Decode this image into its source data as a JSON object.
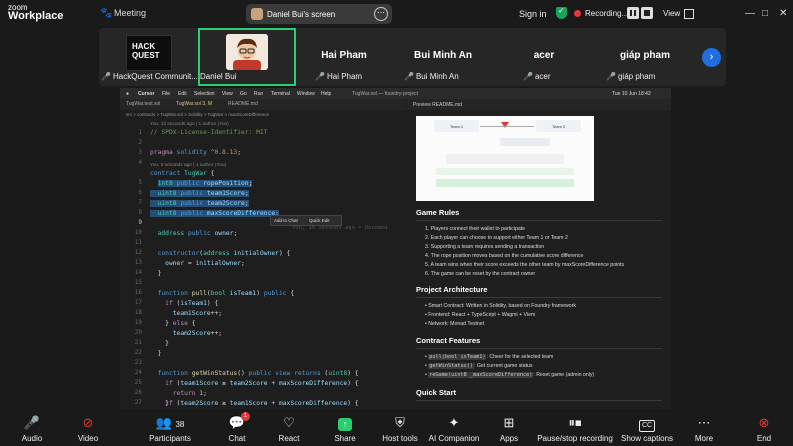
{
  "app": {
    "brand_top": "zoom",
    "brand_bottom": "Workplace",
    "meeting_label": "Meeting"
  },
  "share_pill": {
    "label": "Daniel Bui's screen"
  },
  "top_right": {
    "signin": "Sign in",
    "recording": "Recording...",
    "view": "View"
  },
  "participants": [
    {
      "big": "",
      "name": "HackQuest Communit..."
    },
    {
      "big": "",
      "name": "Daniel Bui"
    },
    {
      "big": "Hai Pham",
      "name": "Hai Pham"
    },
    {
      "big": "Bui Minh An",
      "name": "Bui Minh An"
    },
    {
      "big": "acer",
      "name": "acer"
    },
    {
      "big": "giáp pham",
      "name": "giáp pham"
    }
  ],
  "hq_logo_text": "HACK QUEST",
  "mac": {
    "menu": [
      "Cursor",
      "File",
      "Edit",
      "Selection",
      "View",
      "Go",
      "Run",
      "Terminal",
      "Window",
      "Help"
    ],
    "window_title": "TugWar.sol — foundry-project",
    "clock": "Tue 10 Jun 18:42"
  },
  "editor": {
    "tabs": [
      "TugWar.test.sol",
      "TugWar.sol 3, M",
      "README.md"
    ],
    "breadcrumb": "src > contracts > TugWar.sol > Solidity > TugWar > maxScoreDifference",
    "preview_tab": "Preview README.md",
    "popup_add": "Add to Chat",
    "popup_edit": "Quick Edit",
    "ghost": "You, 16 seconds ago • Uncommi",
    "blame1": "You, 12 seconds ago | 1 author (You)",
    "blame2": "You, 5 seconds ago | 1 author (You)",
    "line_numbers": [
      "1",
      "2",
      "3",
      "4",
      "5",
      "6",
      "7",
      "8",
      "9",
      "10",
      "11",
      "12",
      "13",
      "14",
      "15",
      "16",
      "17",
      "18",
      "19",
      "20",
      "21",
      "22",
      "23",
      "24",
      "25",
      "26",
      "27",
      "28",
      "29",
      "30",
      "31",
      "32",
      "33",
      "34"
    ]
  },
  "readme": {
    "game_rules_title": "Game Rules",
    "game_rules": [
      "1. Players connect their wallet to participate",
      "2. Each player can choose to support either Team 1 or Team 2",
      "3. Supporting a team requires sending a transaction",
      "4. The rope position moves based on the cumulative score difference",
      "5. A team wins when their score exceeds the other team by maxScoreDifference points",
      "6. The game can be reset by the contract owner"
    ],
    "arch_title": "Project Architecture",
    "arch": [
      "• Smart Contract: Written in Solidity, based on Foundry framework",
      "• Frontend: React + TypeScript + Wagmi + Viem",
      "• Network: Monad Testnet"
    ],
    "features_title": "Contract Features",
    "features": [
      {
        "code": "pull(bool isTeam1)",
        "text": ": Cheer for the selected team"
      },
      {
        "code": "getWinStatus()",
        "text": ": Get current game status"
      },
      {
        "code": "reGame(uint8 _maxScoreDifference)",
        "text": ": Reset game (admin only)"
      }
    ],
    "quickstart_title": "Quick Start",
    "img_team1": "Team 1",
    "img_team2": "Team 2"
  },
  "toolbar": {
    "audio": "Audio",
    "video": "Video",
    "participants": "Participants",
    "participants_count": "38",
    "chat": "Chat",
    "chat_badge": "1",
    "react": "React",
    "share": "Share",
    "host_tools": "Host tools",
    "ai": "AI Companion",
    "apps": "Apps",
    "pause_rec": "Pause/stop recording",
    "captions": "Show captions",
    "more": "More",
    "end": "End"
  },
  "colors": {
    "accent_green": "#2ecc71",
    "record_red": "#e23b3b",
    "end_red": "#e53935",
    "blue": "#1f6fe0",
    "selection": "#264f78"
  }
}
